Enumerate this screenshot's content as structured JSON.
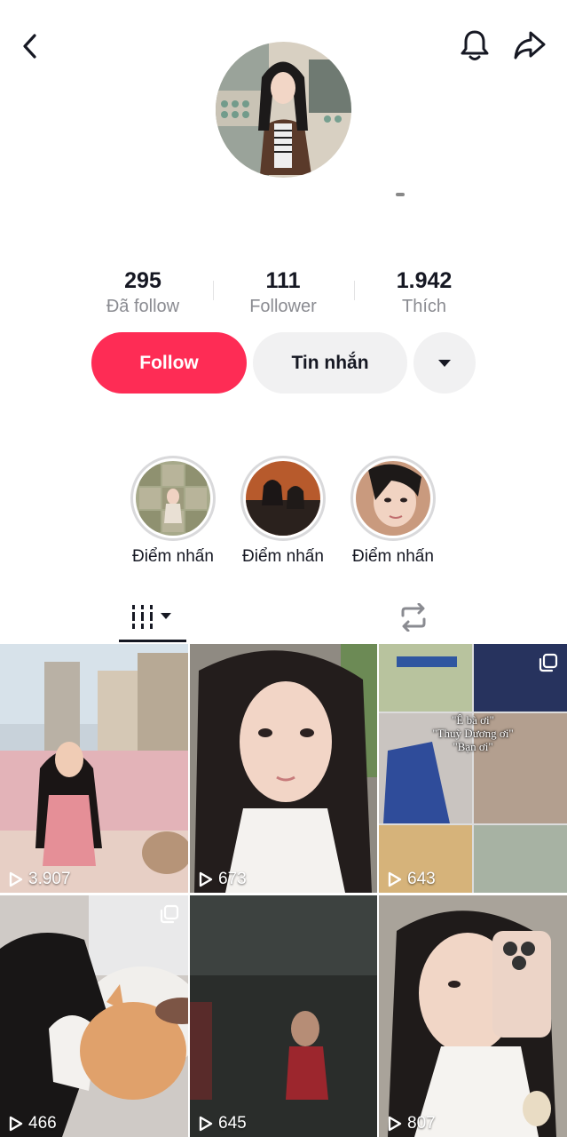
{
  "header": {
    "back_icon": "chevron-left-icon",
    "bell_icon": "bell-icon",
    "share_icon": "share-arrow-icon"
  },
  "stats": [
    {
      "value": "295",
      "label": "Đã follow"
    },
    {
      "value": "111",
      "label": "Follower"
    },
    {
      "value": "1.942",
      "label": "Thích"
    }
  ],
  "actions": {
    "follow_label": "Follow",
    "message_label": "Tin nhắn",
    "more_icon": "caret-down-icon"
  },
  "highlights": [
    {
      "label": "Điểm nhấn"
    },
    {
      "label": "Điểm nhấn"
    },
    {
      "label": "Điểm nhấn"
    }
  ],
  "tabs": {
    "videos_icon": "grid-videos-icon",
    "repost_icon": "repost-icon"
  },
  "videos": [
    {
      "views": "3.907"
    },
    {
      "views": "673"
    },
    {
      "views": "643",
      "caption_lines": [
        "\"Ê bà ơi\"",
        "\"Thuỳ Dương ơi\"",
        "\"Bạn ơi\""
      ]
    },
    {
      "views": "466"
    },
    {
      "views": "645"
    },
    {
      "views": "807"
    }
  ],
  "colors": {
    "accent": "#fe2c55",
    "text_primary": "#161823",
    "text_secondary": "#8a8b91",
    "button_gray": "#f1f1f2"
  }
}
